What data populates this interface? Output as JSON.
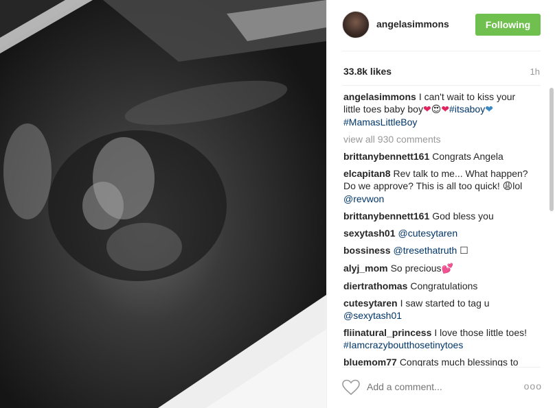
{
  "post": {
    "image_name": "ultrasound-photo"
  },
  "header": {
    "username": "angelasimmons",
    "follow_label": "Following"
  },
  "stats": {
    "likes": "33.8k likes",
    "time": "1h"
  },
  "caption": {
    "user": "angelasimmons",
    "text": "I can't wait to kiss your little toes baby boy",
    "hashtag1": "#itsaboy",
    "hashtag2": "#MamasLittleBoy"
  },
  "view_all": "view all 930 comments",
  "comments": [
    {
      "user": "brittanybennett161",
      "text": "Congrats Angela"
    },
    {
      "user": "elcapitan8",
      "text": "Rev talk to me... What happen? Do we approve? This is all too quick!",
      "after": "lol",
      "mention": "@revwon"
    },
    {
      "user": "brittanybennett161",
      "text": "God bless you"
    },
    {
      "user": "sexytash01",
      "mention": "@cutesytaren"
    },
    {
      "user": "bossiness",
      "mention": "@tresethatruth"
    },
    {
      "user": "alyj_mom",
      "text": "So precious"
    },
    {
      "user": "diertrathomas",
      "text": "Congratulations"
    },
    {
      "user": "cutesytaren",
      "text": "I saw started to tag u",
      "mention": "@sexytash01"
    },
    {
      "user": "fliinatural_princess",
      "text": "I love those little toes!",
      "hashtag": "#Iamcrazyboutthosetinytoes"
    },
    {
      "user": "bluemom77",
      "text": "Congrats much blessings to"
    }
  ],
  "footer": {
    "placeholder": "Add a comment...",
    "more": "ooo"
  },
  "colors": {
    "follow_green": "#70c050",
    "link_blue": "#003569"
  }
}
